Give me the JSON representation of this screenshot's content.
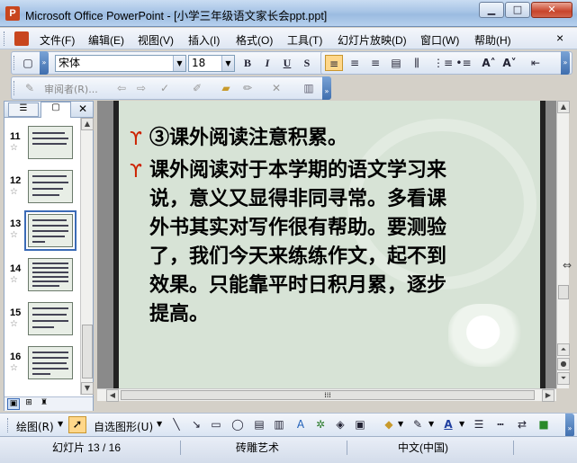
{
  "window": {
    "title": "Microsoft Office PowerPoint - [小学三年级语文家长会ppt.ppt]",
    "app_icon_letter": "P"
  },
  "menu": {
    "items": [
      "文件(F)",
      "编辑(E)",
      "视图(V)",
      "插入(I)",
      "格式(O)",
      "工具(T)",
      "幻灯片放映(D)",
      "窗口(W)",
      "帮助(H)"
    ],
    "close_doc": "×"
  },
  "formatting": {
    "font_name": "宋体",
    "font_size": "18",
    "bold": "B",
    "italic": "I",
    "underline": "U",
    "shadow": "S"
  },
  "reviewing": {
    "reviewer_label": "审阅者(R)..."
  },
  "thumbnails": [
    {
      "num": "11",
      "star": "☆"
    },
    {
      "num": "12",
      "star": "☆"
    },
    {
      "num": "13",
      "star": "☆"
    },
    {
      "num": "14",
      "star": "☆"
    },
    {
      "num": "15",
      "star": "☆"
    },
    {
      "num": "16",
      "star": "☆"
    }
  ],
  "slide": {
    "bullet_symbol": "ϒ",
    "lines": [
      "③课外阅读注意积累。",
      "课外阅读对于本学期的语文学习来",
      "说，意义又显得非同寻常。多看课",
      "外书其实对写作很有帮助。要测验",
      "了，我们今天来练练作文，起不到",
      "效果。只能靠平时日积月累，逐步",
      "提高。"
    ]
  },
  "drawing": {
    "draw_label": "绘图(R)",
    "autoshape_label": "自选图形(U)"
  },
  "status": {
    "slide_info": "幻灯片 13 / 16",
    "design": "砖雕艺术",
    "language": "中文(中国)"
  },
  "colors": {
    "accent": "#cc2200",
    "slide_bg": "#d7e3d6",
    "title_bar": "#a7c4e6"
  }
}
